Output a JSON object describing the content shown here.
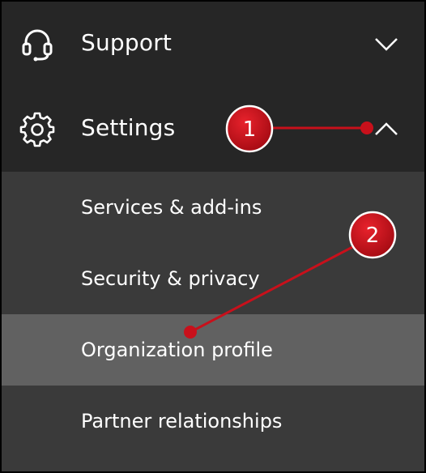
{
  "nav": {
    "support": {
      "label": "Support",
      "icon": "headset-icon",
      "state_icon": "chevron-down-icon"
    },
    "settings": {
      "label": "Settings",
      "icon": "gear-icon",
      "state_icon": "chevron-up-icon"
    }
  },
  "settings_menu": {
    "items": [
      {
        "label": "Services & add-ins"
      },
      {
        "label": "Security & privacy"
      },
      {
        "label": "Organization profile",
        "selected": true
      },
      {
        "label": "Partner relationships"
      }
    ]
  },
  "callouts": [
    {
      "number": "1"
    },
    {
      "number": "2"
    }
  ],
  "colors": {
    "nav_background": "#262626",
    "submenu_background": "#3a3a3a",
    "selected_background": "#616161",
    "callout_red": "#c8101b",
    "text": "#ffffff"
  }
}
